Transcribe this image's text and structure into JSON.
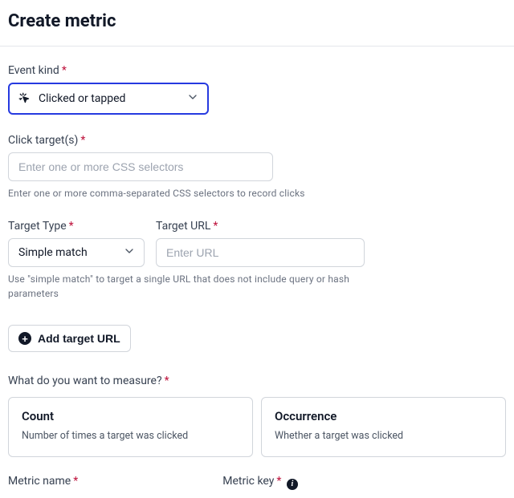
{
  "page_title": "Create metric",
  "event_kind": {
    "label": "Event kind",
    "selected": "Clicked or tapped"
  },
  "click_targets": {
    "label": "Click target(s)",
    "placeholder": "Enter one or more CSS selectors",
    "help": "Enter one or more comma-separated CSS selectors to record clicks"
  },
  "target_type": {
    "label": "Target Type",
    "selected": "Simple match"
  },
  "target_url": {
    "label": "Target URL",
    "placeholder": "Enter URL"
  },
  "target_help": "Use \"simple match\" to target a single URL that does not include query or hash parameters",
  "add_url_label": "Add target URL",
  "measure_question": "What do you want to measure?",
  "measure_options": [
    {
      "title": "Count",
      "desc": "Number of times a target was clicked"
    },
    {
      "title": "Occurrence",
      "desc": "Whether a target was clicked"
    }
  ],
  "metric_name_label": "Metric name",
  "metric_key_label": "Metric key"
}
